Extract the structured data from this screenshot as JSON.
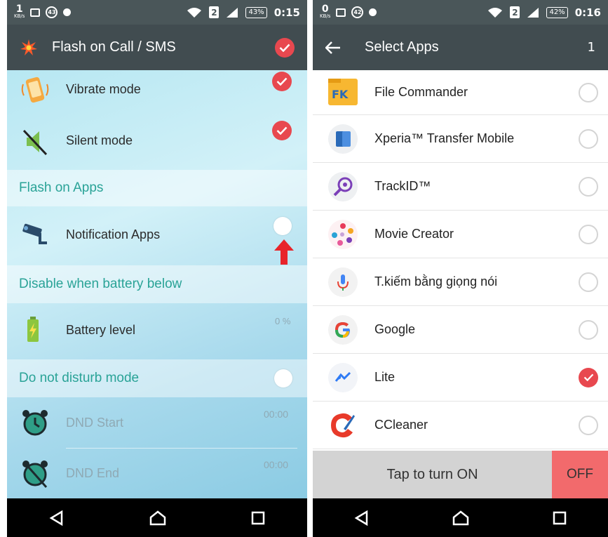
{
  "left": {
    "status": {
      "speed_value": "1",
      "speed_unit": "KB/s",
      "notif_count": "43",
      "sim": "2",
      "battery": "43%",
      "time": "0:15"
    },
    "appbar": {
      "title": "Flash on Call / SMS"
    },
    "rows": {
      "vibrate": "Vibrate mode",
      "silent": "Silent mode",
      "notification_apps": "Notification Apps",
      "battery_level": "Battery level",
      "battery_value": "0 %",
      "dnd_start": "DND Start",
      "dnd_start_value": "00:00",
      "dnd_end": "DND End",
      "dnd_end_value": "00:00"
    },
    "sections": {
      "flash_on_apps": "Flash on Apps",
      "disable_battery": "Disable when battery below",
      "dnd_mode": "Do not disturb mode"
    }
  },
  "right": {
    "status": {
      "speed_value": "0",
      "speed_unit": "KB/s",
      "notif_count": "42",
      "sim": "2",
      "battery": "42%",
      "time": "0:16"
    },
    "appbar": {
      "title": "Select Apps",
      "count": "1"
    },
    "apps": [
      {
        "name": "File Commander",
        "selected": false
      },
      {
        "name": "Xperia™ Transfer Mobile",
        "selected": false
      },
      {
        "name": "TrackID™",
        "selected": false
      },
      {
        "name": "Movie Creator",
        "selected": false
      },
      {
        "name": "T.kiếm bằng giọng nói",
        "selected": false
      },
      {
        "name": "Google",
        "selected": false
      },
      {
        "name": "Lite",
        "selected": true
      },
      {
        "name": "CCleaner",
        "selected": false
      }
    ],
    "bottom": {
      "tap_label": "Tap to turn ON",
      "off_label": "OFF"
    }
  },
  "colors": {
    "accent_red": "#e8484f",
    "teal_text": "#2aa397",
    "appbar": "#414c50"
  }
}
